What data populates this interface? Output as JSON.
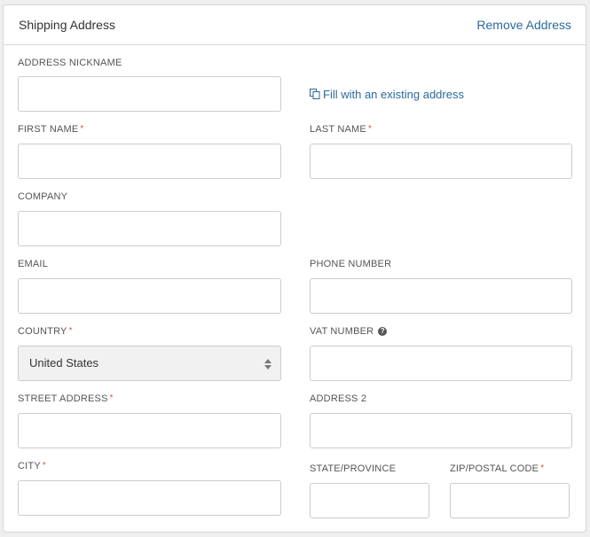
{
  "header": {
    "title": "Shipping Address",
    "remove_label": "Remove Address"
  },
  "fill_link": {
    "icon": "copy-icon",
    "label": "Fill with an existing address"
  },
  "fields": {
    "nickname": {
      "label": "ADDRESS NICKNAME",
      "value": ""
    },
    "first_name": {
      "label": "FIRST NAME",
      "required": "*",
      "value": ""
    },
    "last_name": {
      "label": "LAST NAME",
      "required": "*",
      "value": ""
    },
    "company": {
      "label": "COMPANY",
      "value": ""
    },
    "email": {
      "label": "EMAIL",
      "value": ""
    },
    "phone": {
      "label": "PHONE NUMBER",
      "value": ""
    },
    "country": {
      "label": "COUNTRY",
      "required": "*",
      "value": "United States"
    },
    "vat": {
      "label": "VAT NUMBER",
      "help_icon": "?",
      "value": ""
    },
    "street": {
      "label": "STREET ADDRESS",
      "required": "*",
      "value": ""
    },
    "address2": {
      "label": "ADDRESS 2",
      "value": ""
    },
    "city": {
      "label": "CITY",
      "required": "*",
      "value": ""
    },
    "state": {
      "label": "STATE/PROVINCE",
      "value": ""
    },
    "zip": {
      "label": "ZIP/POSTAL CODE",
      "required": "*",
      "value": ""
    }
  }
}
